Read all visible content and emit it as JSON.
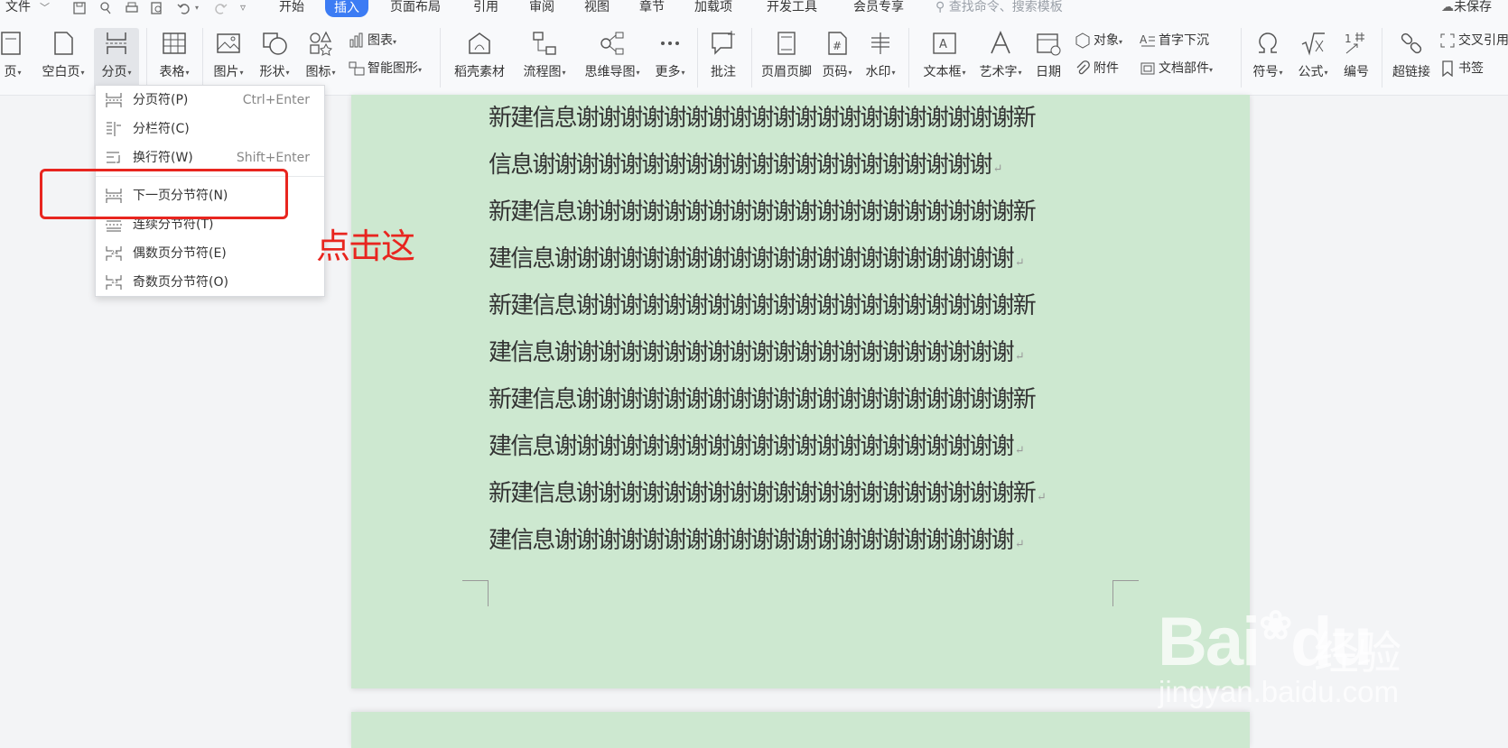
{
  "topbar": {
    "file_menu": "文件",
    "tabs": [
      "开始",
      "插入",
      "页面布局",
      "引用",
      "审阅",
      "视图",
      "章节",
      "加载项",
      "开发工具",
      "会员专享"
    ],
    "active_tab": "插入",
    "search_placeholder": "查找命令、搜索模板",
    "save_status": "未保存"
  },
  "ribbon": {
    "cover_page": "页",
    "blank_page": "空白页",
    "page_break": "分页",
    "table": "表格",
    "picture": "图片",
    "shape": "形状",
    "icon": "图标",
    "chart": "图表",
    "smart_art": "智能图形",
    "daoke_assets": "稻壳素材",
    "flowchart": "流程图",
    "mindmap": "思维导图",
    "more": "更多",
    "comment": "批注",
    "header_footer": "页眉页脚",
    "page_number": "页码",
    "watermark": "水印",
    "textbox": "文本框",
    "wordart": "艺术字",
    "date": "日期",
    "object": "对象",
    "attachment": "附件",
    "drop_cap": "首字下沉",
    "doc_parts": "文档部件",
    "symbol": "符号",
    "formula": "公式",
    "numbering": "编号",
    "hyperlink": "超链接",
    "cross_ref": "交叉引用",
    "bookmark": "书签"
  },
  "menu": {
    "items": [
      {
        "label": "分页符(P)",
        "shortcut": "Ctrl+Enter"
      },
      {
        "label": "分栏符(C)",
        "shortcut": ""
      },
      {
        "label": "换行符(W)",
        "shortcut": "Shift+Enter"
      },
      {
        "label": "下一页分节符(N)",
        "shortcut": ""
      },
      {
        "label": "连续分节符(T)",
        "shortcut": ""
      },
      {
        "label": "偶数页分节符(E)",
        "shortcut": ""
      },
      {
        "label": "奇数页分节符(O)",
        "shortcut": ""
      }
    ]
  },
  "annotation": "点击这",
  "document": {
    "lines": [
      "新建信息谢谢谢谢谢谢谢谢谢谢谢谢谢谢谢谢谢谢谢谢新",
      "信息谢谢谢谢谢谢谢谢谢谢谢谢谢谢谢谢谢谢谢谢谢",
      "新建信息谢谢谢谢谢谢谢谢谢谢谢谢谢谢谢谢谢谢谢谢新",
      "建信息谢谢谢谢谢谢谢谢谢谢谢谢谢谢谢谢谢谢谢谢谢",
      "新建信息谢谢谢谢谢谢谢谢谢谢谢谢谢谢谢谢谢谢谢谢新",
      "建信息谢谢谢谢谢谢谢谢谢谢谢谢谢谢谢谢谢谢谢谢谢",
      "新建信息谢谢谢谢谢谢谢谢谢谢谢谢谢谢谢谢谢谢谢谢新",
      "建信息谢谢谢谢谢谢谢谢谢谢谢谢谢谢谢谢谢谢谢谢谢",
      "新建信息谢谢谢谢谢谢谢谢谢谢谢谢谢谢谢谢谢谢谢谢新",
      "建信息谢谢谢谢谢谢谢谢谢谢谢谢谢谢谢谢谢谢谢谢谢"
    ],
    "page_background": "#cde8d0"
  },
  "watermark": {
    "brand": "Bai",
    "brand2": "du",
    "product": "经验",
    "url": "jingyan.baidu.com"
  },
  "colors": {
    "accent": "#3c7cf4",
    "highlight_red": "#e8251f"
  }
}
